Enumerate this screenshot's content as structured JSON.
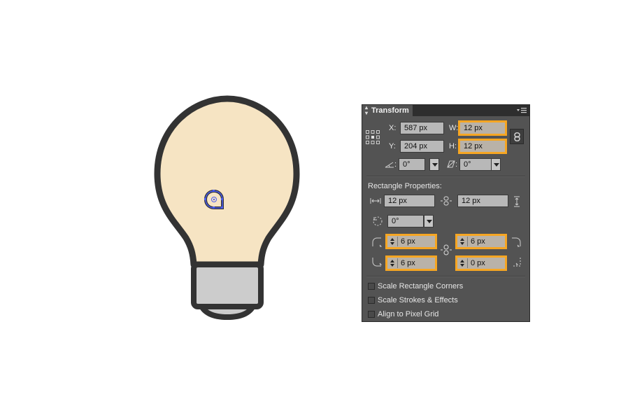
{
  "panel": {
    "title": "Transform",
    "x_label": "X:",
    "x_value": "587 px",
    "y_label": "Y:",
    "y_value": "204 px",
    "w_label": "W:",
    "w_value": "12 px",
    "h_label": "H:",
    "h_value": "12 px",
    "rotate_value": "0°",
    "shear_value": "0°",
    "rect_section_title": "Rectangle Properties:",
    "rect_width": "12 px",
    "rect_height": "12 px",
    "rect_rotate": "0°",
    "corner_tl": "6 px",
    "corner_tr": "6 px",
    "corner_bl": "6 px",
    "corner_br": "0 px",
    "checkboxes": [
      {
        "label": "Scale Rectangle Corners",
        "checked": false
      },
      {
        "label": "Scale Strokes & Effects",
        "checked": false
      },
      {
        "label": "Align to Pixel Grid",
        "checked": false
      }
    ]
  },
  "colors": {
    "bulb_fill": "#f6e4c3",
    "outline": "#333333",
    "base_fill": "#cccccc",
    "selection": "#4a5cf0",
    "highlight": "#f6a623"
  },
  "icons": [
    "reference-point-icon",
    "link-icon",
    "rotate-icon",
    "shear-icon",
    "panel-menu-icon"
  ]
}
